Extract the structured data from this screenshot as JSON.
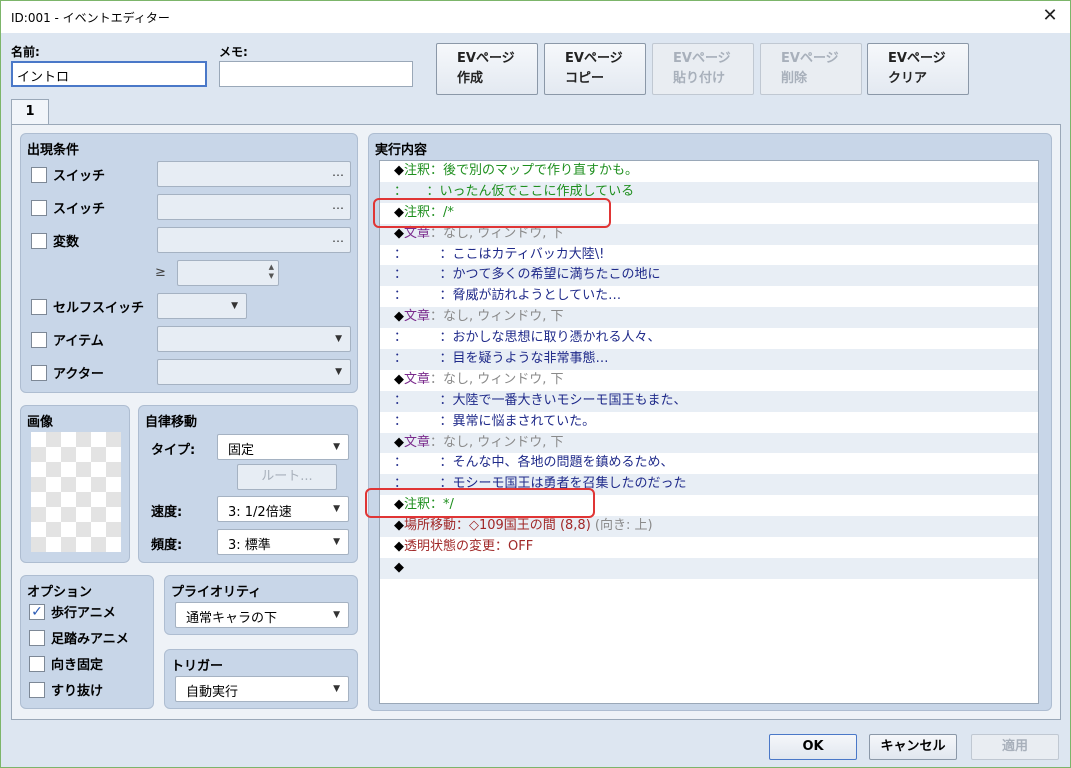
{
  "window": {
    "title": "ID:001 - イベントエディター",
    "close_glyph": "✕"
  },
  "header": {
    "name_label": "名前:",
    "name_value": "イントロ",
    "memo_label": "メモ:",
    "memo_value": ""
  },
  "ev_buttons": [
    {
      "line1": "EVページ",
      "line2": "作成",
      "enabled": true
    },
    {
      "line1": "EVページ",
      "line2": "コピー",
      "enabled": true
    },
    {
      "line1": "EVページ",
      "line2": "貼り付け",
      "enabled": false
    },
    {
      "line1": "EVページ",
      "line2": "削除",
      "enabled": false
    },
    {
      "line1": "EVページ",
      "line2": "クリア",
      "enabled": true
    }
  ],
  "tabs": [
    {
      "label": "1"
    }
  ],
  "conditions": {
    "title": "出現条件",
    "switch1": "スイッチ",
    "switch2": "スイッチ",
    "variable": "変数",
    "ge": "≥",
    "self_switch": "セルフスイッチ",
    "item": "アイテム",
    "actor": "アクター",
    "dots": "…"
  },
  "image": {
    "title": "画像"
  },
  "autonomous": {
    "title": "自律移動",
    "type_label": "タイプ:",
    "type_value": "固定",
    "route_button": "ルート...",
    "speed_label": "速度:",
    "speed_value": "3: 1/2倍速",
    "freq_label": "頻度:",
    "freq_value": "3: 標準"
  },
  "options": {
    "title": "オプション",
    "items": [
      {
        "label": "歩行アニメ",
        "checked": true
      },
      {
        "label": "足踏みアニメ",
        "checked": false
      },
      {
        "label": "向き固定",
        "checked": false
      },
      {
        "label": "すり抜け",
        "checked": false
      }
    ]
  },
  "priority": {
    "title": "プライオリティ",
    "value": "通常キャラの下"
  },
  "trigger": {
    "title": "トリガー",
    "value": "自動実行"
  },
  "contents": {
    "title": "実行内容",
    "lines": [
      {
        "parts": [
          {
            "t": "◆",
            "c": "#000"
          },
          {
            "t": "注釈：後で別のマップで作り直すかも。",
            "c": "#1e8f1e"
          }
        ]
      },
      {
        "parts": [
          {
            "t": "：　　：いったん仮でここに作成している",
            "c": "#1e8f1e"
          }
        ]
      },
      {
        "parts": [
          {
            "t": "◆",
            "c": "#000"
          },
          {
            "t": "注釈：/*",
            "c": "#1e8f1e"
          }
        ]
      },
      {
        "parts": [
          {
            "t": "◆",
            "c": "#000"
          },
          {
            "t": "文章",
            "c": "#7a2a8c"
          },
          {
            "t": "：なし, ウィンドウ, 下",
            "c": "#8a8a8a"
          }
        ]
      },
      {
        "parts": [
          {
            "t": "：　　　：ここはカティバッカ大陸\\!",
            "c": "#1f2a8a"
          }
        ]
      },
      {
        "parts": [
          {
            "t": "：　　　：かつて多くの希望に満ちたこの地に",
            "c": "#1f2a8a"
          }
        ]
      },
      {
        "parts": [
          {
            "t": "：　　　：脅威が訪れようとしていた…",
            "c": "#1f2a8a"
          }
        ]
      },
      {
        "parts": [
          {
            "t": "◆",
            "c": "#000"
          },
          {
            "t": "文章",
            "c": "#7a2a8c"
          },
          {
            "t": "：なし, ウィンドウ, 下",
            "c": "#8a8a8a"
          }
        ]
      },
      {
        "parts": [
          {
            "t": "：　　　：おかしな思想に取り憑かれる人々、",
            "c": "#1f2a8a"
          }
        ]
      },
      {
        "parts": [
          {
            "t": "：　　　：目を疑うような非常事態…",
            "c": "#1f2a8a"
          }
        ]
      },
      {
        "parts": [
          {
            "t": "◆",
            "c": "#000"
          },
          {
            "t": "文章",
            "c": "#7a2a8c"
          },
          {
            "t": "：なし, ウィンドウ, 下",
            "c": "#8a8a8a"
          }
        ]
      },
      {
        "parts": [
          {
            "t": "：　　　：大陸で一番大きいモシーモ国王もまた、",
            "c": "#1f2a8a"
          }
        ]
      },
      {
        "parts": [
          {
            "t": "：　　　：異常に悩まされていた。",
            "c": "#1f2a8a"
          }
        ]
      },
      {
        "parts": [
          {
            "t": "◆",
            "c": "#000"
          },
          {
            "t": "文章",
            "c": "#7a2a8c"
          },
          {
            "t": "：なし, ウィンドウ, 下",
            "c": "#8a8a8a"
          }
        ]
      },
      {
        "parts": [
          {
            "t": "：　　　：そんな中、各地の問題を鎮めるため、",
            "c": "#1f2a8a"
          }
        ]
      },
      {
        "parts": [
          {
            "t": "：　　　：モシーモ国王は勇者を召集したのだった",
            "c": "#1f2a8a"
          }
        ]
      },
      {
        "parts": [
          {
            "t": "◆",
            "c": "#000"
          },
          {
            "t": "注釈：*/",
            "c": "#1e8f1e"
          }
        ]
      },
      {
        "parts": [
          {
            "t": "◆",
            "c": "#000"
          },
          {
            "t": "場所移動：◇109国王の間 (8,8)",
            "c": "#a02828"
          },
          {
            "t": " (向き: 上)",
            "c": "#8a8a8a"
          }
        ]
      },
      {
        "parts": [
          {
            "t": "◆",
            "c": "#000"
          },
          {
            "t": "透明状態の変更：OFF",
            "c": "#a02828"
          }
        ]
      },
      {
        "parts": [
          {
            "t": "◆",
            "c": "#000"
          }
        ]
      }
    ]
  },
  "footer": {
    "ok": "OK",
    "cancel": "キャンセル",
    "apply": "適用"
  },
  "colors": {
    "accent": "#4a78c8",
    "highlight": "#e03535",
    "comment": "#1e8f1e",
    "text": "#1f2a8a"
  }
}
